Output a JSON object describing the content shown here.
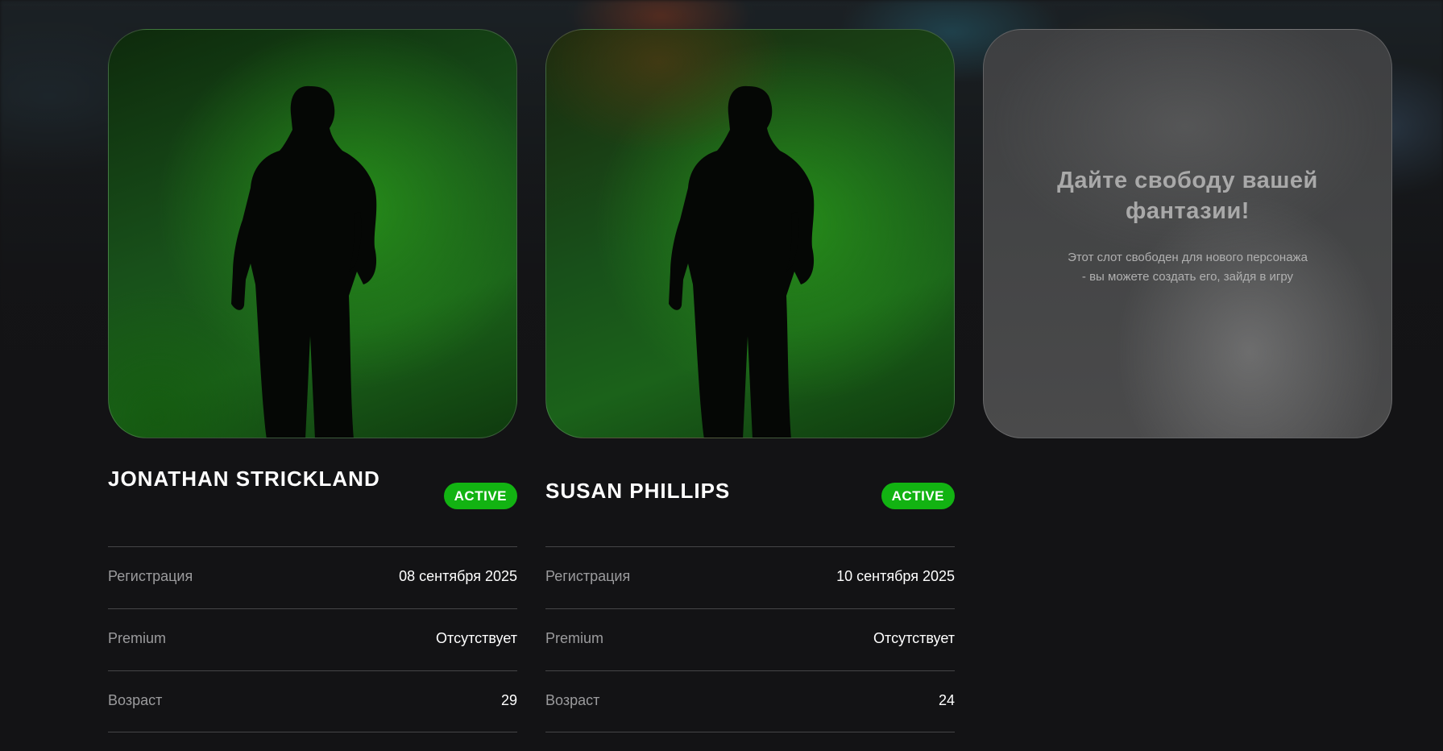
{
  "characters": [
    {
      "name": "JONATHAN STRICKLAND",
      "status": "ACTIVE",
      "stats": [
        {
          "label": "Регистрация",
          "value": "08 сентября 2025"
        },
        {
          "label": "Premium",
          "value": "Отсутствует"
        },
        {
          "label": "Возраст",
          "value": "29"
        }
      ]
    },
    {
      "name": "SUSAN PHILLIPS",
      "status": "ACTIVE",
      "stats": [
        {
          "label": "Регистрация",
          "value": "10 сентября 2025"
        },
        {
          "label": "Premium",
          "value": "Отсутствует"
        },
        {
          "label": "Возраст",
          "value": "24"
        }
      ]
    }
  ],
  "empty_slot": {
    "title": "Дайте свободу вашей фантазии!",
    "text": "Этот слот свободен для нового персонажа - вы можете создать его, зайдя в игру"
  },
  "colors": {
    "page_background": "#131315",
    "status_active": "#12b312",
    "card_green": "#1b621a"
  }
}
